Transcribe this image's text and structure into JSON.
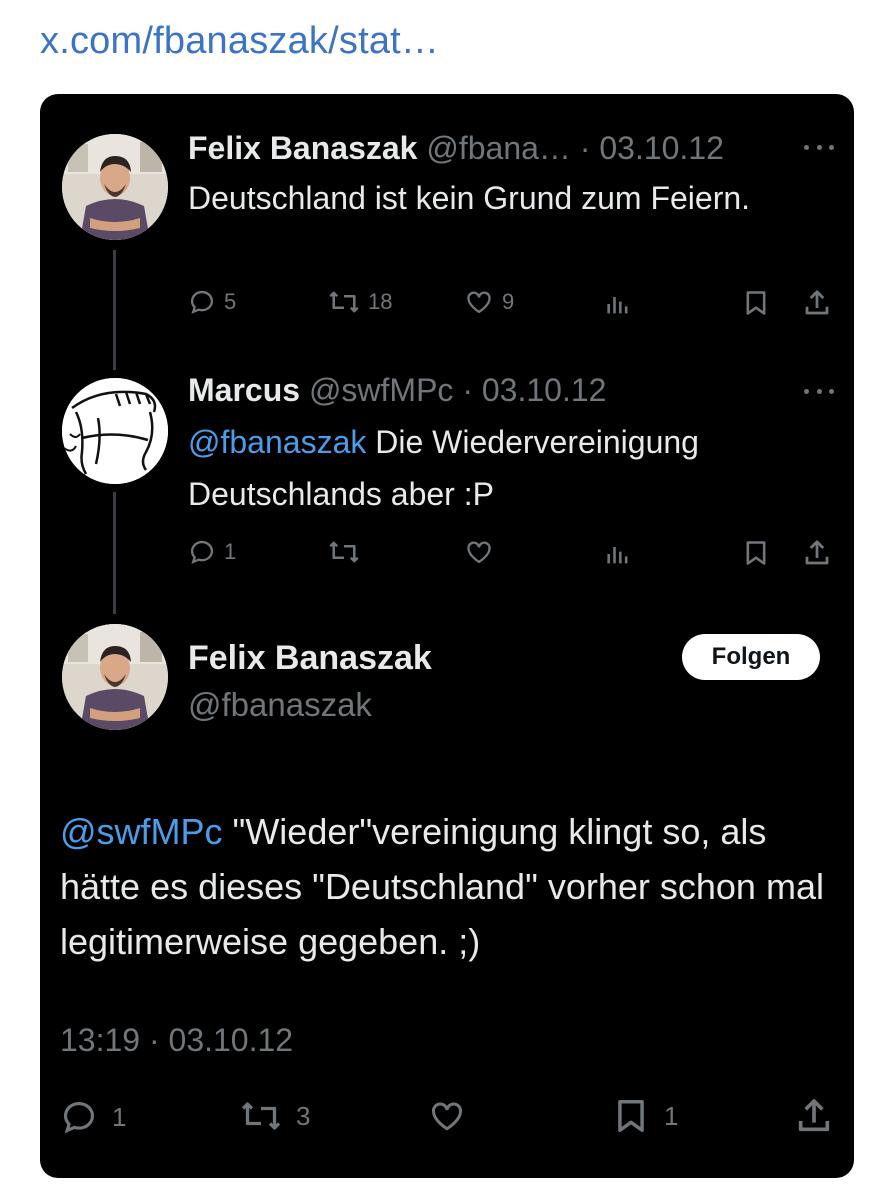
{
  "link": {
    "text": "x.com/fbanaszak/stat…"
  },
  "tweets": [
    {
      "author": "Felix Banaszak",
      "handle": "@fbana…",
      "separator": " · ",
      "date": "03.10.12",
      "text": "Deutschland ist kein Grund zum Feiern.",
      "replies": "5",
      "retweets": "18",
      "likes": "9"
    },
    {
      "author": "Marcus",
      "handle": "@swfMPc",
      "separator": " · ",
      "date": "03.10.12",
      "mention": "@fbanaszak",
      "text": " Die Wiedervereinigung Deutschlands aber :P",
      "replies": "1",
      "retweets": "",
      "likes": ""
    }
  ],
  "main": {
    "author": "Felix Banaszak",
    "handle": "@fbanaszak",
    "follow_label": "Folgen",
    "mention": "@swfMPc",
    "text": " \"Wieder\"vereinigung klingt so, als hätte es dieses \"Deutschland\" vorher schon mal legitimerweise gegeben. ;)",
    "meta": "13:19 · 03.10.12",
    "replies": "1",
    "retweets": "3",
    "likes": "",
    "bookmarks": "1"
  },
  "icons": [
    "reply-icon",
    "retweet-icon",
    "like-icon",
    "views-icon",
    "bookmark-icon",
    "share-icon",
    "more-icon"
  ],
  "colors": {
    "background": "#000000",
    "link": "#3b73c5",
    "mention": "#4a9de8",
    "text": "#e7e9ea",
    "muted": "#71767b"
  }
}
